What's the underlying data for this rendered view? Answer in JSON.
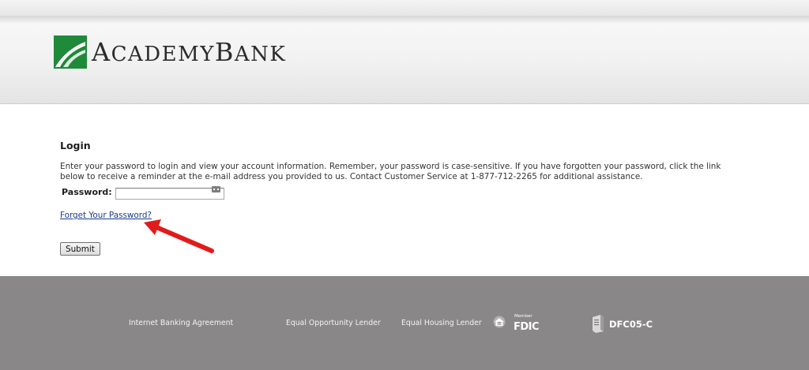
{
  "brand": {
    "name_part1": "ACADEMY",
    "name_part2": "BANK",
    "accent_color": "#1f8a3a"
  },
  "login": {
    "title": "Login",
    "intro_text": "Enter your password to login and view your account information. Remember, your password is case-sensitive. If you have forgotten your password, click the link below to receive a reminder at the e-mail address you provided to us. Contact Customer Service at 1-877-712-2265 for additional assistance.",
    "password_label": "Password:",
    "password_value": "",
    "forgot_link": "Forget Your Password?",
    "submit_label": "Submit"
  },
  "footer": {
    "internet_banking_agreement": "Internet Banking Agreement",
    "equal_opportunity": "Equal Opportunity Lender",
    "equal_housing": "Equal Housing Lender",
    "fdic_member": "Member",
    "fdic": "FDIC",
    "server_code": "DFC05-C",
    "icons": [
      "equal-housing-icon",
      "server-icon",
      "password-key-icon"
    ]
  }
}
